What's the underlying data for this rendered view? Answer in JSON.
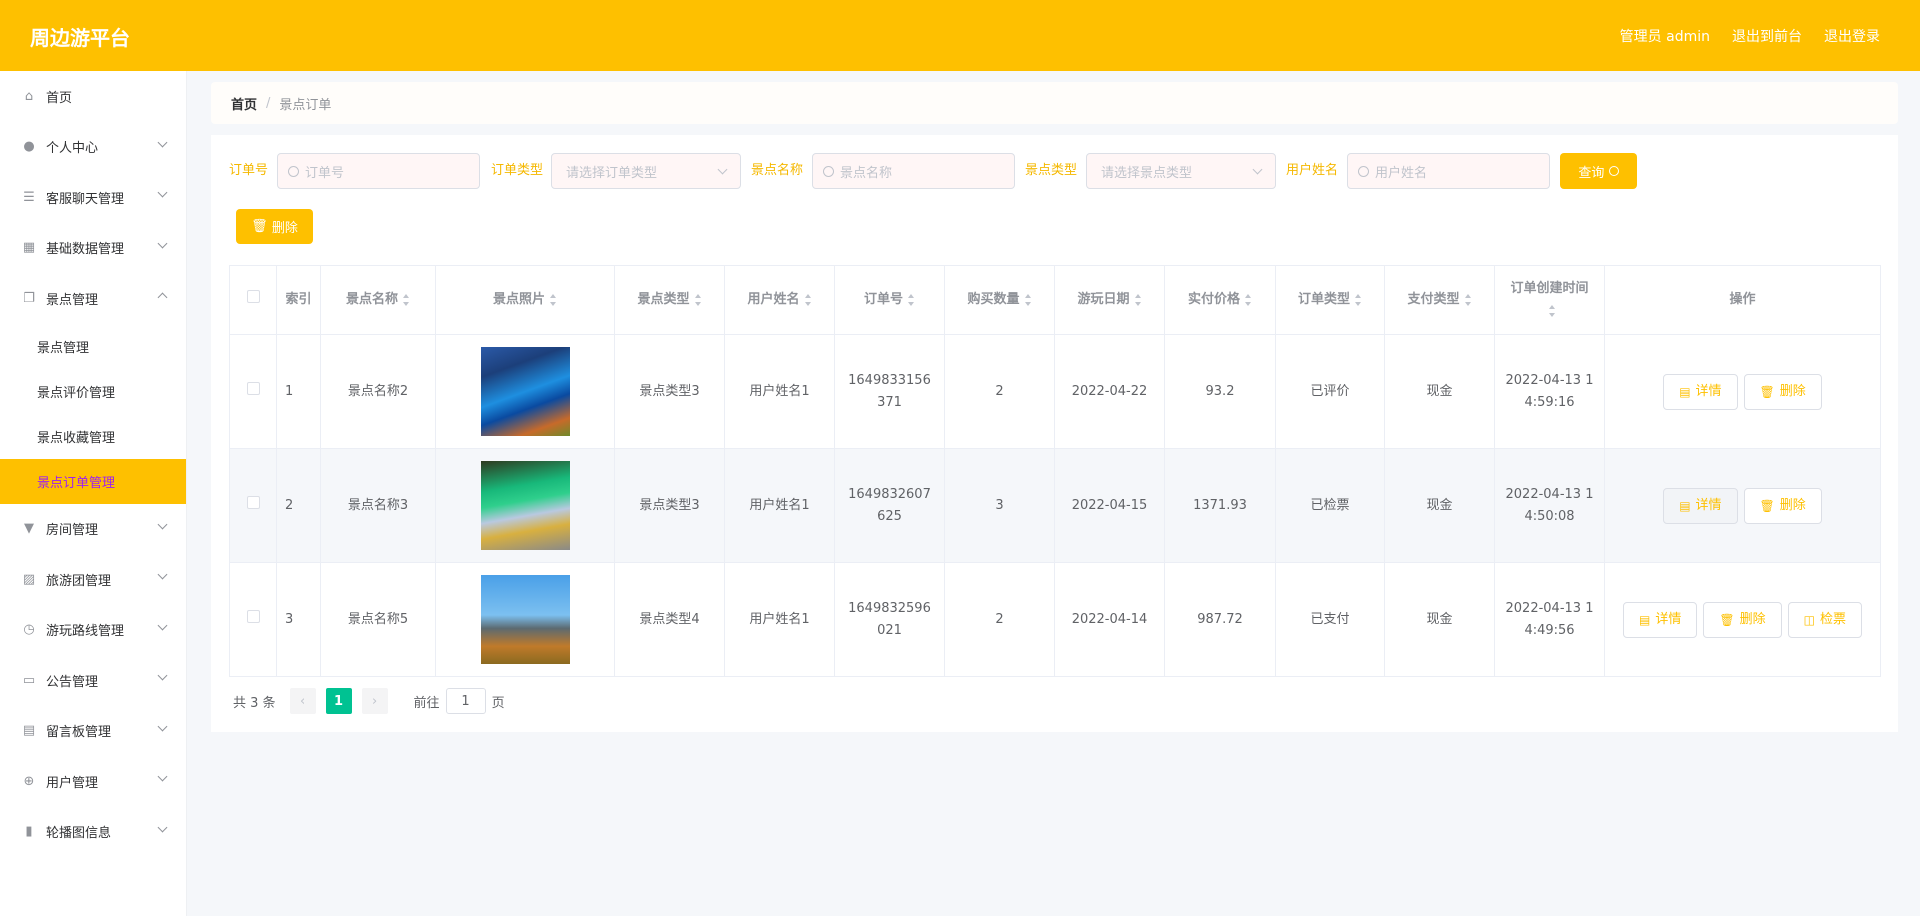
{
  "header": {
    "title": "周边游平台",
    "user": "管理员 admin",
    "front": "退出到前台",
    "logout": "退出登录"
  },
  "colors": {
    "primary": "#fec000",
    "active_text": "#a020f0",
    "page_active": "#00c292"
  },
  "sidebar": {
    "items": [
      {
        "label": "首页",
        "icon": "home-icon"
      },
      {
        "label": "个人中心",
        "icon": "user-icon"
      },
      {
        "label": "客服聊天管理",
        "icon": "list-icon"
      },
      {
        "label": "基础数据管理",
        "icon": "grid-icon"
      },
      {
        "label": "景点管理",
        "icon": "copy-icon",
        "expanded": true,
        "children": [
          "景点管理",
          "景点评价管理",
          "景点收藏管理",
          "景点订单管理"
        ],
        "active_child": 3
      },
      {
        "label": "房间管理",
        "icon": "brush-icon"
      },
      {
        "label": "旅游团管理",
        "icon": "chart-icon"
      },
      {
        "label": "游玩路线管理",
        "icon": "clock-icon"
      },
      {
        "label": "公告管理",
        "icon": "message-icon"
      },
      {
        "label": "留言板管理",
        "icon": "board-icon"
      },
      {
        "label": "用户管理",
        "icon": "target-icon"
      },
      {
        "label": "轮播图信息",
        "icon": "bar-chart-icon"
      }
    ]
  },
  "breadcrumb": {
    "home": "首页",
    "sep": "/",
    "current": "景点订单"
  },
  "search": {
    "order_no": {
      "label": "订单号",
      "placeholder": "订单号"
    },
    "order_type": {
      "label": "订单类型",
      "placeholder": "请选择订单类型"
    },
    "spot_name": {
      "label": "景点名称",
      "placeholder": "景点名称"
    },
    "spot_type": {
      "label": "景点类型",
      "placeholder": "请选择景点类型"
    },
    "user_name": {
      "label": "用户姓名",
      "placeholder": "用户姓名"
    },
    "query": "查询"
  },
  "toolbar": {
    "delete": "删除"
  },
  "table": {
    "columns": [
      "索引",
      "景点名称",
      "景点照片",
      "景点类型",
      "用户姓名",
      "订单号",
      "购买数量",
      "游玩日期",
      "实付价格",
      "订单类型",
      "支付类型",
      "订单创建时间",
      "操作"
    ],
    "rows": [
      {
        "index": "1",
        "name": "景点名称2",
        "type": "景点类型3",
        "user": "用户姓名1",
        "order_no": "1649833156371",
        "qty": "2",
        "date": "2022-04-22",
        "price": "93.2",
        "order_type": "已评价",
        "pay": "现金",
        "created": "2022-04-13 14:59:16",
        "actions": [
          "详情",
          "删除"
        ]
      },
      {
        "index": "2",
        "name": "景点名称3",
        "type": "景点类型3",
        "user": "用户姓名1",
        "order_no": "1649832607625",
        "qty": "3",
        "date": "2022-04-15",
        "price": "1371.93",
        "order_type": "已检票",
        "pay": "现金",
        "created": "2022-04-13 14:50:08",
        "actions": [
          "详情",
          "删除"
        ]
      },
      {
        "index": "3",
        "name": "景点名称5",
        "type": "景点类型4",
        "user": "用户姓名1",
        "order_no": "1649832596021",
        "qty": "2",
        "date": "2022-04-14",
        "price": "987.72",
        "order_type": "已支付",
        "pay": "现金",
        "created": "2022-04-13 14:49:56",
        "actions": [
          "详情",
          "删除",
          "检票"
        ]
      }
    ]
  },
  "pagination": {
    "total": "共 3 条",
    "current": "1",
    "goto": "前往",
    "goto_value": "1",
    "page_suffix": "页"
  }
}
